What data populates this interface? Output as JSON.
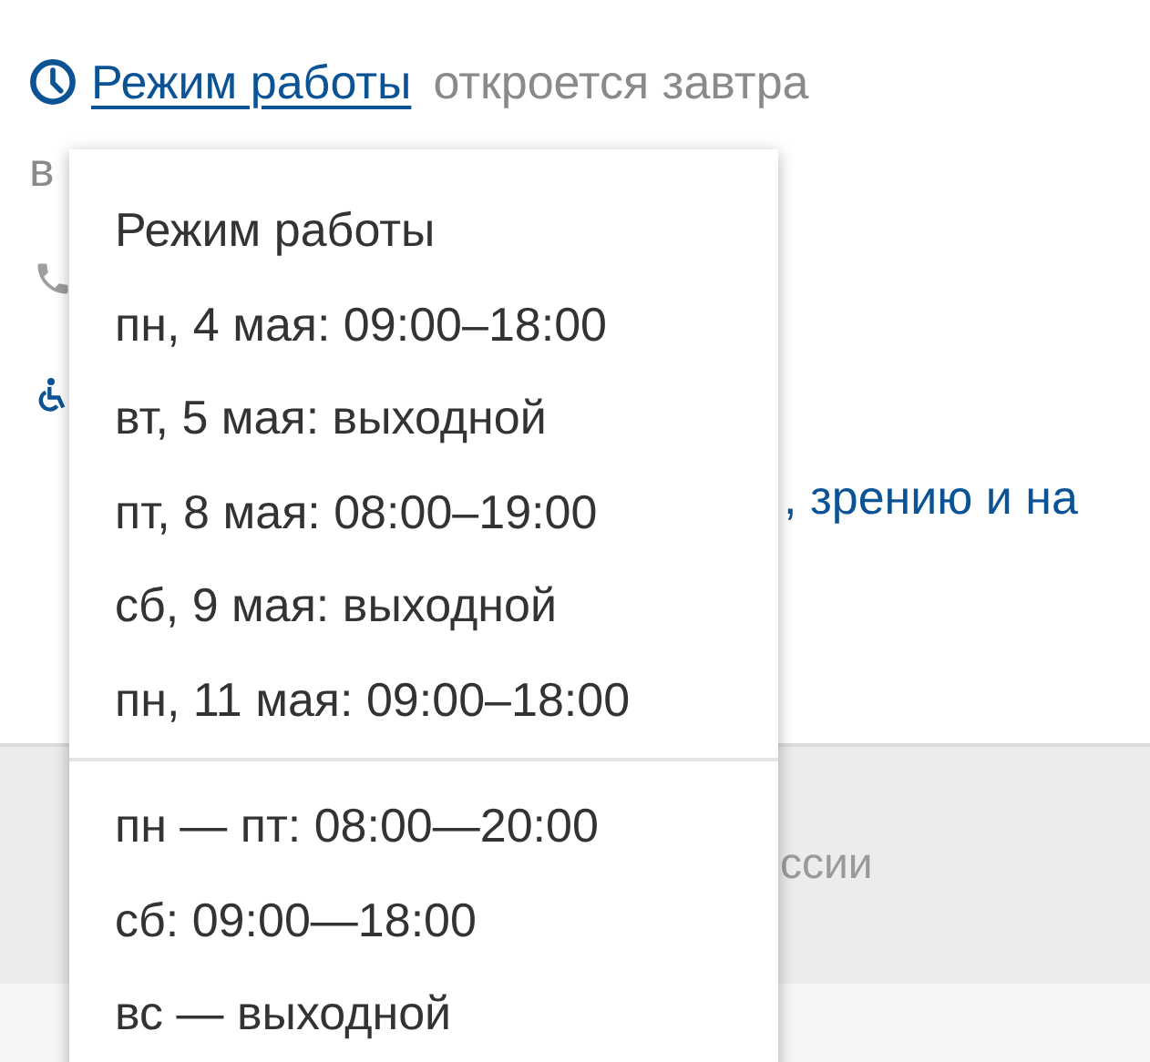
{
  "hours": {
    "link": "Режим работы",
    "status": "откроется завтра",
    "status_continued": "в"
  },
  "accessibility": {
    "text": ", зрению и на"
  },
  "footer": {
    "text": "ссии"
  },
  "popup": {
    "title": "Режим работы",
    "special_days": [
      "пн, 4 мая: 09:00–18:00",
      "вт, 5 мая: выходной",
      "пт, 8 мая: 08:00–19:00",
      "сб, 9 мая: выходной",
      "пн, 11 мая: 09:00–18:00"
    ],
    "regular": [
      "пн — пт: 08:00—20:00",
      "сб: 09:00—18:00",
      "вс — выходной"
    ]
  }
}
